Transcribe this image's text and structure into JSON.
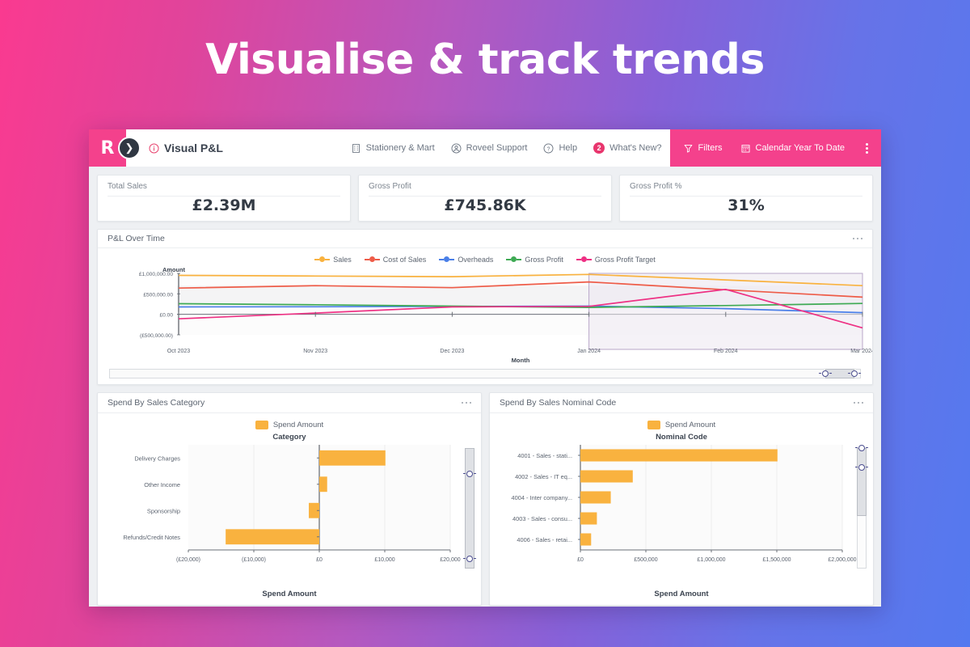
{
  "hero": {
    "title": "Visualise & track trends"
  },
  "topbar": {
    "logo_letter": "R",
    "nav_toggle_icon": "chevron-right-icon",
    "info_icon": "info-icon",
    "page_title": "Visual P&L",
    "nav_items": [
      {
        "icon": "building-icon",
        "label": "Stationery & Mart"
      },
      {
        "icon": "user-circle-icon",
        "label": "Roveel Support"
      },
      {
        "icon": "question-circle-icon",
        "label": "Help"
      },
      {
        "icon": "badge-count",
        "badge": "2",
        "label": "What's New?"
      }
    ],
    "actions": [
      {
        "icon": "filter-icon",
        "label": "Filters"
      },
      {
        "icon": "calendar-icon",
        "label": "Calendar Year To Date"
      }
    ],
    "kebab_icon": "more-vertical-icon",
    "accent_color": "#f4418c"
  },
  "kpis": [
    {
      "label": "Total Sales",
      "value": "£2.39M"
    },
    {
      "label": "Gross Profit",
      "value": "£745.86K"
    },
    {
      "label": "Gross Profit %",
      "value": "31%"
    }
  ],
  "panels": {
    "pl_over_time": {
      "title": "P&L Over Time",
      "menu_icon": "more-horizontal-icon"
    },
    "spend_category": {
      "title": "Spend By Sales Category",
      "menu_icon": "more-horizontal-icon"
    },
    "spend_nominal": {
      "title": "Spend By Sales Nominal Code",
      "menu_icon": "more-horizontal-icon"
    }
  },
  "chart_data": [
    {
      "id": "pl-over-time",
      "type": "line",
      "title": "P&L Over Time",
      "xlabel": "Month",
      "ylabel": "Amount",
      "x": [
        "Oct 2023",
        "Nov 2023",
        "Dec 2023",
        "Jan 2024",
        "Feb 2024",
        "Mar 2024"
      ],
      "ylim": [
        -500000,
        1000000
      ],
      "yticks": [
        1000000,
        500000,
        0,
        -500000
      ],
      "ytick_labels": [
        "£1,000,000.00",
        "£500,000.00",
        "£0.00",
        "(£500,000.00)"
      ],
      "grid": true,
      "legend_position": "top",
      "selection": {
        "from": "Jan 2024",
        "to": "Mar 2024"
      },
      "series": [
        {
          "name": "Sales",
          "color": "#f9b23f",
          "values": [
            950000,
            935000,
            920000,
            975000,
            840000,
            700000
          ]
        },
        {
          "name": "Cost of Sales",
          "color": "#ee5c48",
          "values": [
            640000,
            700000,
            650000,
            790000,
            600000,
            420000
          ]
        },
        {
          "name": "Overheads",
          "color": "#4a7fe8",
          "values": [
            180000,
            185000,
            195000,
            200000,
            140000,
            40000
          ]
        },
        {
          "name": "Gross Profit",
          "color": "#3faa54",
          "values": [
            260000,
            235000,
            200000,
            170000,
            215000,
            265000
          ]
        },
        {
          "name": "Gross Profit Target",
          "color": "#ee3184",
          "values": [
            -110000,
            30000,
            180000,
            195000,
            610000,
            -330000
          ]
        }
      ]
    },
    {
      "id": "spend-by-sales-category",
      "type": "bar",
      "orientation": "horizontal",
      "title": "Spend By Sales Category",
      "axis_title": "Category",
      "xlabel": "Spend Amount",
      "legend": [
        "Spend Amount"
      ],
      "series_color": "#f9b23f",
      "xlim": [
        -20000,
        20000
      ],
      "xticks": [
        -20000,
        -10000,
        0,
        10000,
        20000
      ],
      "xtick_labels": [
        "(£20,000)",
        "(£10,000)",
        "£0",
        "£10,000",
        "£20,000"
      ],
      "categories": [
        "Delivery Charges",
        "Other Income",
        "Sponsorship",
        "Refunds/Credit Notes"
      ],
      "values": [
        10100,
        1200,
        -1600,
        -14300
      ]
    },
    {
      "id": "spend-by-sales-nominal-code",
      "type": "bar",
      "orientation": "horizontal",
      "title": "Spend By Sales Nominal Code",
      "axis_title": "Nominal Code",
      "xlabel": "Spend Amount",
      "legend": [
        "Spend Amount"
      ],
      "series_color": "#f9b23f",
      "xlim": [
        0,
        2000000
      ],
      "xticks": [
        0,
        500000,
        1000000,
        1500000,
        2000000
      ],
      "xtick_labels": [
        "£0",
        "£500,000",
        "£1,000,000",
        "£1,500,000",
        "£2,000,000"
      ],
      "categories": [
        "4001 - Sales - stati...",
        "4002 - Sales - IT eq...",
        "4004 - Inter company...",
        "4003 - Sales - consu...",
        "4006 - Sales - retai..."
      ],
      "values": [
        1505000,
        400000,
        232000,
        126000,
        82000
      ]
    }
  ]
}
